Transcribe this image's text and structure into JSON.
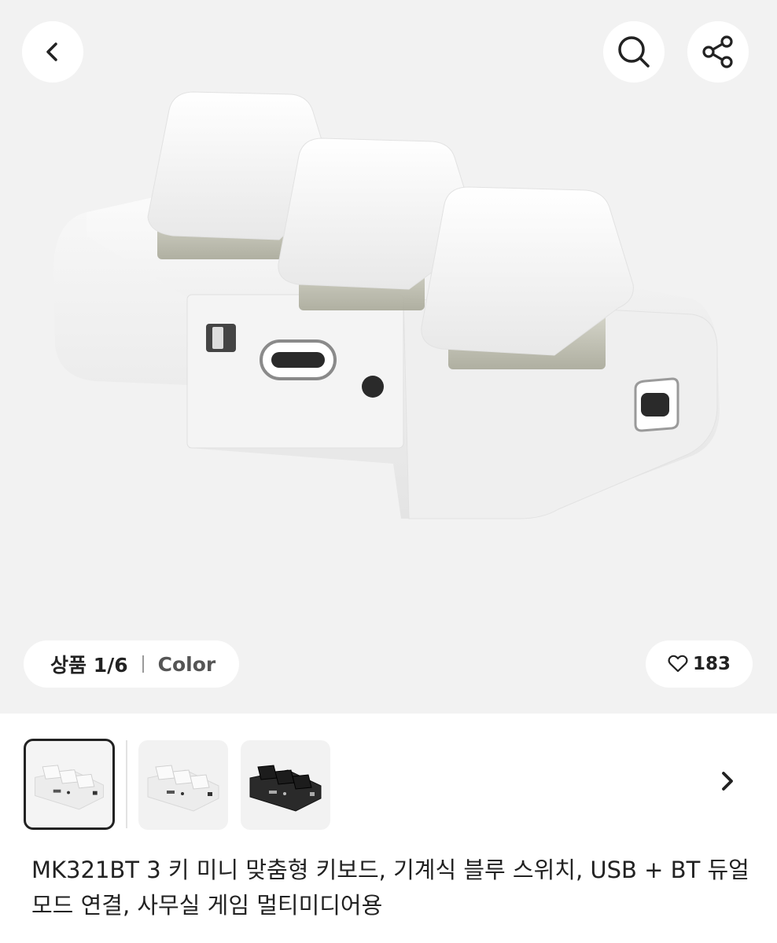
{
  "header": {
    "back_icon": "chevron-left-icon",
    "search_icon": "search-icon",
    "share_icon": "share-icon"
  },
  "gallery": {
    "counter_label": "상품 1/6",
    "option_label": "Color",
    "likes": "183",
    "like_icon": "heart-outline-icon"
  },
  "thumbnails": [
    {
      "variant": "white",
      "selected": true
    },
    {
      "variant": "white",
      "selected": false
    },
    {
      "variant": "black",
      "selected": false
    }
  ],
  "product": {
    "title": "MK321BT 3 키 미니 맞춤형 키보드, 기계식 블루 스위치, USB + BT 듀얼 모드 연결, 사무실 게임 멀티미디어용"
  },
  "colors": {
    "hero_bg": "#f2f2f2",
    "text": "#222222",
    "selected_border": "#222222"
  }
}
